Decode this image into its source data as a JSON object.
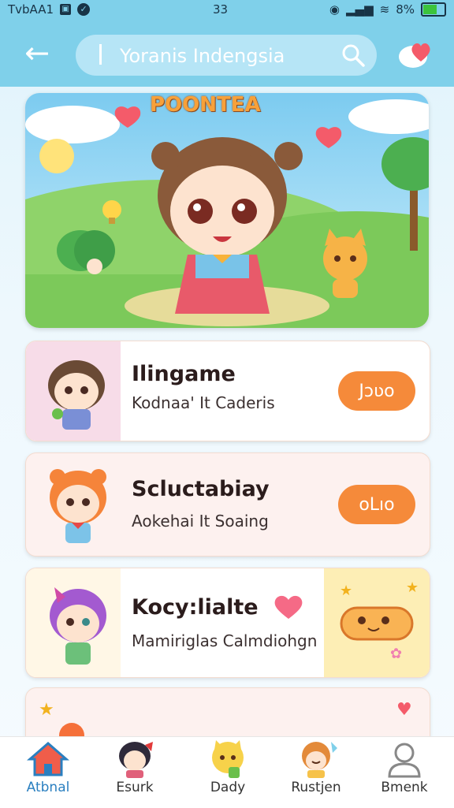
{
  "status_bar": {
    "left_text": "TvbAA1",
    "center_text": "33",
    "battery": "8%"
  },
  "header": {
    "search_text": "Yoranis Indengsia"
  },
  "banner": {
    "title": "POONTEA"
  },
  "cards": [
    {
      "title": "Ilingame",
      "subtitle": "Kodnaa' It Caderis",
      "button": "Jɔʋo"
    },
    {
      "title": "Scluctabiay",
      "subtitle": "Aokehai It Soaing",
      "button": "oLıo"
    },
    {
      "title": "Kocy:lialte",
      "subtitle": "Mamiriglas Calmdiohgn",
      "button": ""
    }
  ],
  "bottom_nav": {
    "items": [
      {
        "label": "Atbnal",
        "icon": "home-icon",
        "active": true
      },
      {
        "label": "Esurk",
        "icon": "character-girl-icon",
        "active": false
      },
      {
        "label": "Dady",
        "icon": "cat-mascot-icon",
        "active": false
      },
      {
        "label": "Rustjen",
        "icon": "character-kid-icon",
        "active": false
      },
      {
        "label": "Bmenk",
        "icon": "profile-icon",
        "active": false
      }
    ]
  },
  "colors": {
    "accent": "#7fd0ea",
    "button": "#f58a3a",
    "active_nav": "#2a7fc0",
    "heart": "#f45b6a"
  }
}
